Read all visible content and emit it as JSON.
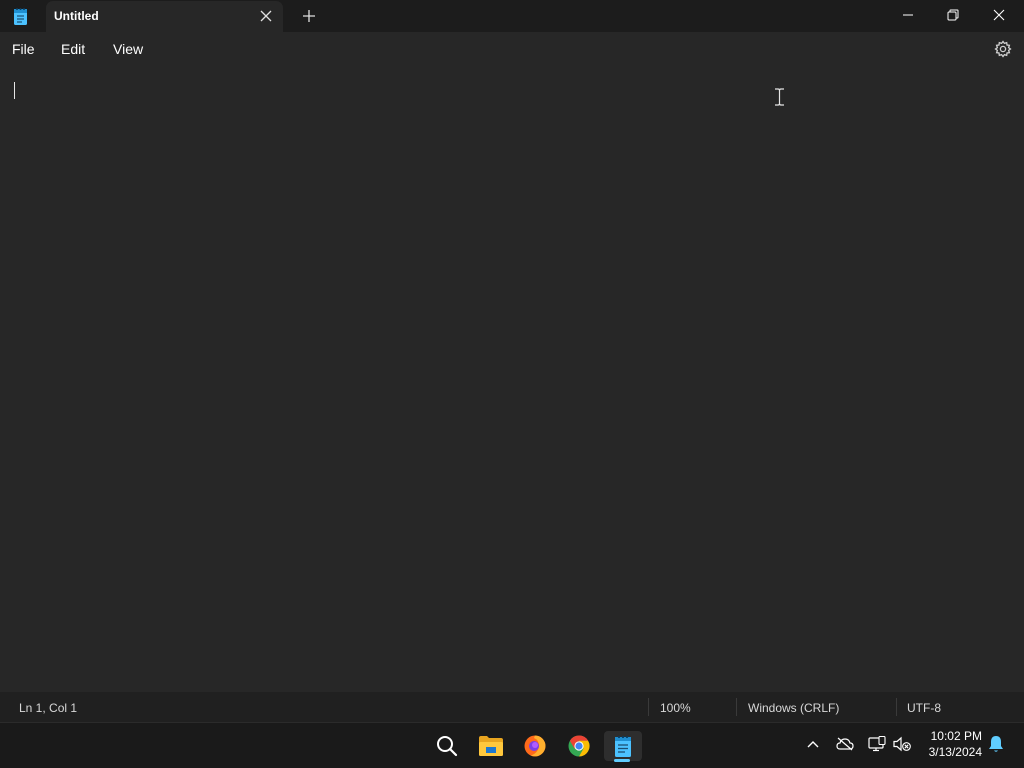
{
  "window": {
    "app_icon": "notepad-icon",
    "tab_title": "Untitled",
    "tab_close_icon": "close-icon",
    "new_tab_icon": "plus-icon",
    "controls": [
      "minimize-icon",
      "restore-icon",
      "close-icon"
    ]
  },
  "menu": {
    "file": "File",
    "edit": "Edit",
    "view": "View",
    "settings_icon": "gear-icon"
  },
  "editor": {
    "content": ""
  },
  "status": {
    "position": "Ln 1, Col 1",
    "zoom": "100%",
    "line_ending": "Windows (CRLF)",
    "encoding": "UTF-8"
  },
  "taskbar": {
    "apps": [
      "search-icon",
      "file-explorer-icon",
      "firefox-icon",
      "chrome-icon",
      "notepad-icon"
    ],
    "active_app": "notepad-icon",
    "tray": [
      "chevron-up-icon",
      "cloud-offline-icon",
      "network-icon",
      "volume-muted-icon",
      "bell-icon"
    ],
    "time": "10:02 PM",
    "date": "3/13/2024"
  },
  "colors": {
    "titlebar": "#1c1c1c",
    "editor_bg": "#272727",
    "statusbar": "#202020",
    "taskbar": "#1a1a1a",
    "accent": "#60cdff"
  }
}
